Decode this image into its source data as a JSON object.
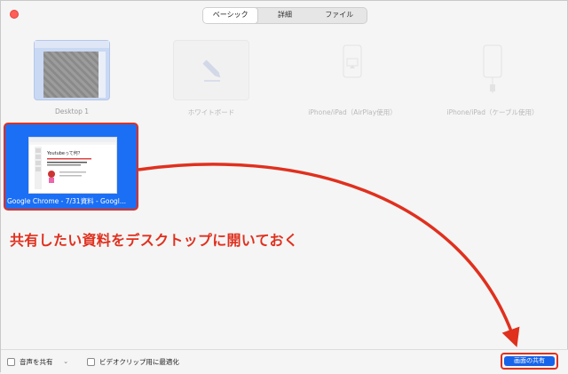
{
  "tabs": [
    {
      "label": "ベーシック",
      "active": true
    },
    {
      "label": "詳細",
      "active": false
    },
    {
      "label": "ファイル",
      "active": false
    }
  ],
  "sources": [
    {
      "label": "Desktop 1"
    },
    {
      "label": "ホワイトボード"
    },
    {
      "label": "iPhone/iPad（AirPlay使用）"
    },
    {
      "label": "iPhone/iPad（ケーブル使用）"
    }
  ],
  "selected_window": {
    "label": "Google Chrome - 7/31資料 - Googl...",
    "preview_title": "Youtubeって何？"
  },
  "annotation": "共有したい資料をデスクトップに開いておく",
  "bottom": {
    "share_audio_label": "音声を共有",
    "optimize_video_label": "ビデオクリップ用に最適化",
    "share_button_label": "画面の共有"
  },
  "colors": {
    "accent_blue": "#1763e9",
    "highlight_red": "#e0301e",
    "annotation_red": "#e0301e"
  }
}
